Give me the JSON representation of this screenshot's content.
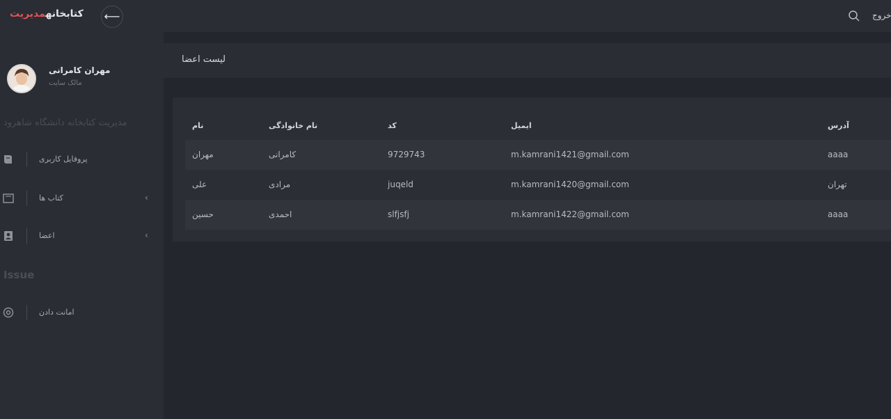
{
  "header": {
    "brand_part1": "کتابخانه",
    "brand_part2": "مدیریت",
    "back_symbol": "⟵",
    "logout_label": "خروج"
  },
  "user": {
    "name": "مهران کامرانی",
    "role": "مالک سایت"
  },
  "sidebar": {
    "section_title": "مدیریت کتابخانه دانشگاه شاهرود",
    "items": [
      {
        "label": "پروفایل کاربری",
        "icon": "book-icon",
        "has_chevron": false
      },
      {
        "label": "کتاب ها",
        "icon": "books-icon",
        "has_chevron": true
      },
      {
        "label": "اعضا",
        "icon": "member-icon",
        "has_chevron": true
      }
    ],
    "issue_title": "Issue",
    "issue_items": [
      {
        "label": "امانت دادن",
        "icon": "settings-icon"
      }
    ],
    "chevron_symbol": "‹"
  },
  "page": {
    "title": "لیست اعضا"
  },
  "table": {
    "headers": [
      "نام",
      "نام خانوادگی",
      "کد",
      "ایمیل",
      "آدرس"
    ],
    "rows": [
      [
        "مهران",
        "کامرانی",
        "9729743",
        "m.kamrani1421@gmail.com",
        "aaaa"
      ],
      [
        "علی",
        "مرادی",
        "juqeld",
        "m.kamrani1420@gmail.com",
        "تهران"
      ],
      [
        "حسین",
        "احمدی",
        "slfjsfj",
        "m.kamrani1422@gmail.com",
        "aaaa"
      ]
    ]
  },
  "colors": {
    "background": "#23262c",
    "panel": "#2a2d33",
    "brand_accent": "#e0525a"
  }
}
